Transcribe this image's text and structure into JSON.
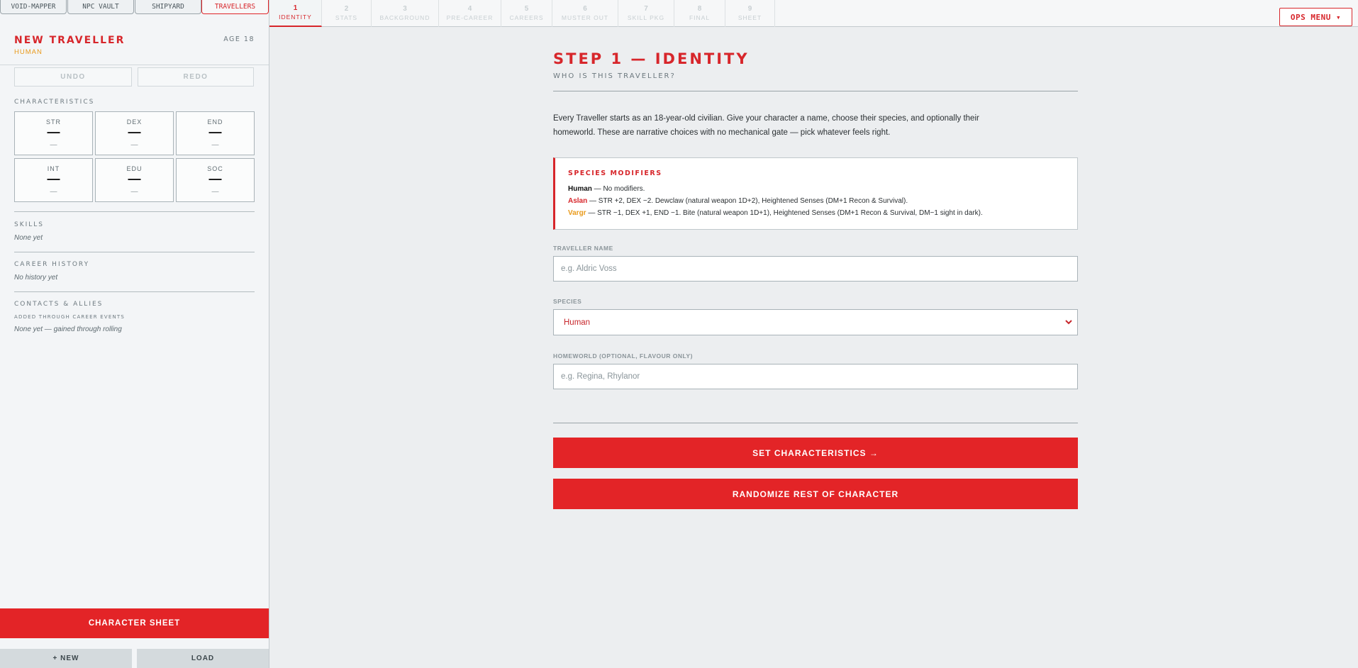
{
  "app_tabs": [
    {
      "label": "VOID-MAPPER",
      "active": false
    },
    {
      "label": "NPC VAULT",
      "active": false
    },
    {
      "label": "SHIPYARD",
      "active": false
    },
    {
      "label": "TRAVELLERS",
      "active": true
    }
  ],
  "traveller": {
    "name": "NEW TRAVELLER",
    "species": "HUMAN",
    "age": "AGE 18"
  },
  "history": {
    "undo": "UNDO",
    "redo": "REDO"
  },
  "characteristics": {
    "label": "CHARACTERISTICS",
    "stats": [
      {
        "key": "STR",
        "value": "—",
        "mod": "—"
      },
      {
        "key": "DEX",
        "value": "—",
        "mod": "—"
      },
      {
        "key": "END",
        "value": "—",
        "mod": "—"
      },
      {
        "key": "INT",
        "value": "—",
        "mod": "—"
      },
      {
        "key": "EDU",
        "value": "—",
        "mod": "—"
      },
      {
        "key": "SOC",
        "value": "—",
        "mod": "—"
      }
    ]
  },
  "skills": {
    "label": "SKILLS",
    "empty": "None yet"
  },
  "career_history": {
    "label": "CAREER HISTORY",
    "empty": "No history yet"
  },
  "contacts": {
    "label": "CONTACTS & ALLIES",
    "note": "ADDED THROUGH CAREER EVENTS",
    "empty": "None yet — gained through rolling"
  },
  "sidebar_buttons": {
    "character_sheet": "CHARACTER SHEET",
    "new": "+ NEW",
    "load": "LOAD"
  },
  "steps": [
    {
      "num": "1",
      "label": "IDENTITY",
      "active": true
    },
    {
      "num": "2",
      "label": "STATS",
      "active": false
    },
    {
      "num": "3",
      "label": "BACKGROUND",
      "active": false
    },
    {
      "num": "4",
      "label": "PRE-CAREER",
      "active": false
    },
    {
      "num": "5",
      "label": "CAREERS",
      "active": false
    },
    {
      "num": "6",
      "label": "MUSTER OUT",
      "active": false
    },
    {
      "num": "7",
      "label": "SKILL PKG",
      "active": false
    },
    {
      "num": "8",
      "label": "FINAL",
      "active": false
    },
    {
      "num": "9",
      "label": "SHEET",
      "active": false
    }
  ],
  "ops_menu": "OPS MENU ▾",
  "main": {
    "title": "STEP 1 — IDENTITY",
    "subtitle": "WHO IS THIS TRAVELLER?",
    "intro": "Every Traveller starts as an 18-year-old civilian. Give your character a name, choose their species, and optionally their homeworld. These are narrative choices with no mechanical gate — pick whatever feels right.",
    "modifiers": {
      "title": "SPECIES MODIFIERS",
      "rows": [
        {
          "species": "Human",
          "text": " — No modifiers.",
          "color": "#111111"
        },
        {
          "species": "Aslan",
          "text": " — STR +2, DEX −2. Dewclaw (natural weapon 1D+2), Heightened Senses (DM+1 Recon & Survival).",
          "color": "#d7262b"
        },
        {
          "species": "Vargr",
          "text": " — STR −1, DEX +1, END −1. Bite (natural weapon 1D+1), Heightened Senses (DM+1 Recon & Survival, DM−1 sight in dark).",
          "color": "#e99a1b"
        }
      ]
    },
    "name_field": {
      "label": "TRAVELLER NAME",
      "placeholder": "e.g. Aldric Voss"
    },
    "species_field": {
      "label": "SPECIES",
      "value": "Human"
    },
    "homeworld_field": {
      "label": "HOMEWORLD (OPTIONAL, FLAVOUR ONLY)",
      "placeholder": "e.g. Regina, Rhylanor"
    },
    "primary_button": "SET CHARACTERISTICS →",
    "random_button": "RANDOMIZE REST OF CHARACTER"
  }
}
